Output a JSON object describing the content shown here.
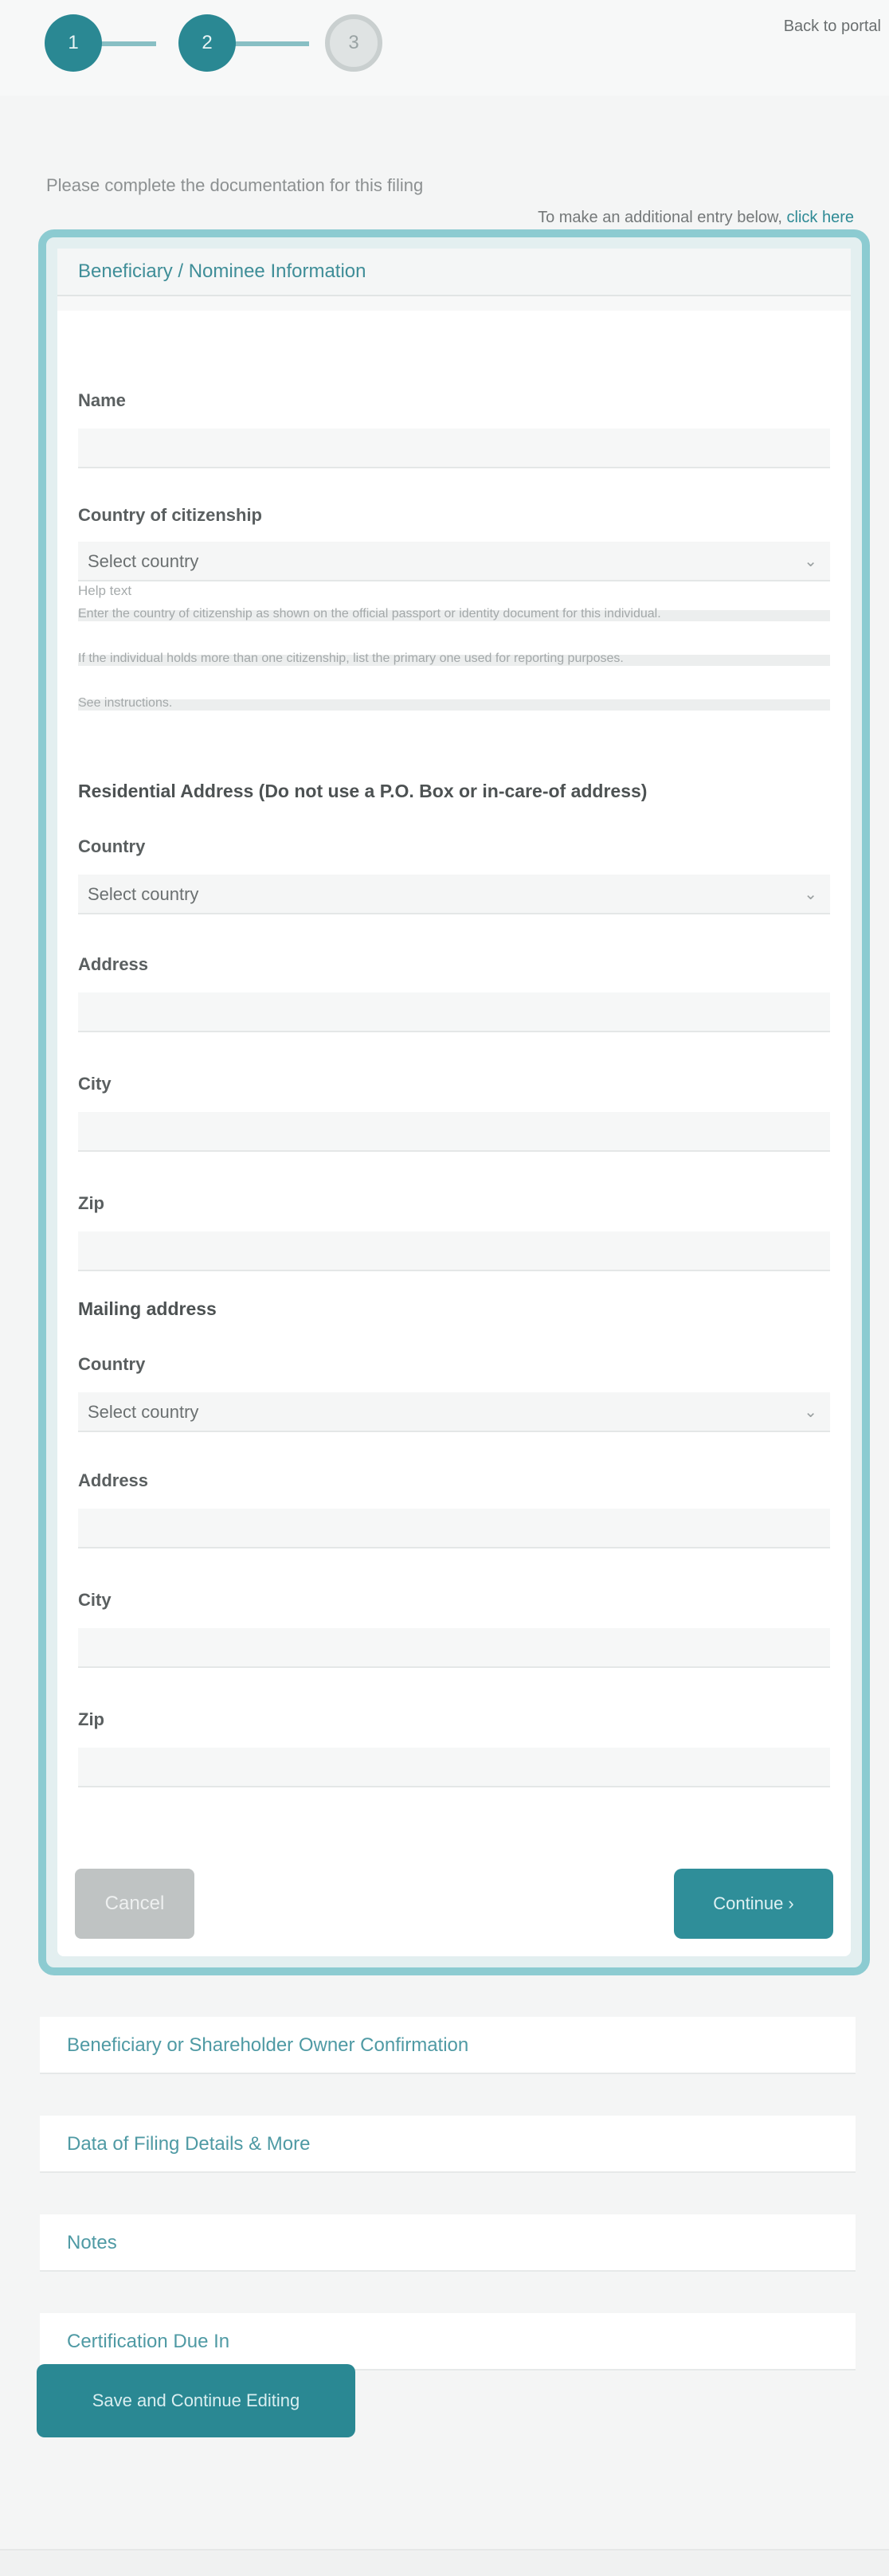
{
  "header": {
    "steps": [
      {
        "number": "1",
        "state": "complete"
      },
      {
        "number": "2",
        "state": "current"
      },
      {
        "number": "3",
        "state": "pending"
      }
    ],
    "back_link": "Back to portal"
  },
  "intro_text": "Please complete the documentation for this filing",
  "manage": {
    "text": "To make an additional entry below,",
    "link": "click here"
  },
  "modal": {
    "title": "Beneficiary / Nominee Information",
    "name_label": "Name",
    "country_label": "Country of citizenship",
    "country_value": "Select country",
    "help_label": "Help text",
    "help_lines": [
      "Enter the country of citizenship as shown on the official passport or identity document for this individual.",
      "If the individual holds more than one citizenship, list the primary one used for reporting purposes.",
      "See instructions."
    ],
    "residential_heading": "Residential Address (Do not use a P.O. Box or in-care-of address)",
    "res_country_label": "Country",
    "res_country_value": "Select country",
    "res_address_label": "Address",
    "res_city_label": "City",
    "res_zip_label": "Zip",
    "mailing_heading": "Mailing address",
    "mail_country_label": "Country",
    "mail_country_value": "Select country",
    "mail_address_label": "Address",
    "mail_city_label": "City",
    "mail_zip_label": "Zip",
    "cancel_label": "Cancel",
    "continue_label": "Continue ›"
  },
  "accordions": [
    "Beneficiary or Shareholder Owner Confirmation",
    "Data of Filing Details & More",
    "Notes",
    "Certification Due In"
  ],
  "save_button_label": "Save and Continue Editing",
  "colors": {
    "primary": "#2a8893",
    "border_accent": "#8ccbd1",
    "link": "#2e8a95"
  },
  "icons": {
    "select_chevron": "⌄"
  }
}
